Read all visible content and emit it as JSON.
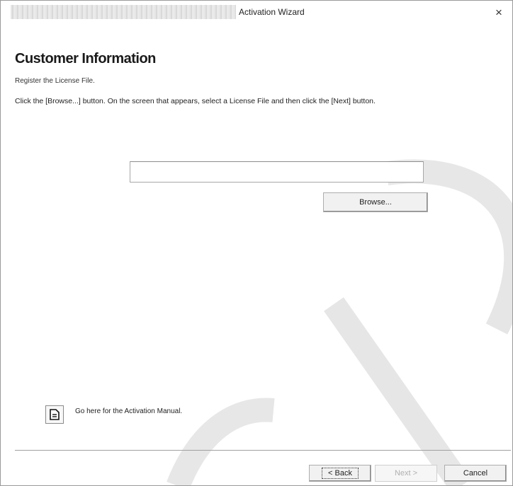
{
  "window": {
    "title": "Activation Wizard",
    "close_label": "×"
  },
  "page": {
    "heading": "Customer Information",
    "subtitle": "Register the License File.",
    "instruction": "Click the [Browse...] button. On the screen that appears, select a License File and then click the [Next] button."
  },
  "license_file": {
    "value": "",
    "placeholder": ""
  },
  "buttons": {
    "browse": "Browse...",
    "back": "< Back",
    "next": "Next >",
    "cancel": "Cancel"
  },
  "manual": {
    "icon": "document-icon",
    "link_text": "Go here for the Activation Manual."
  }
}
